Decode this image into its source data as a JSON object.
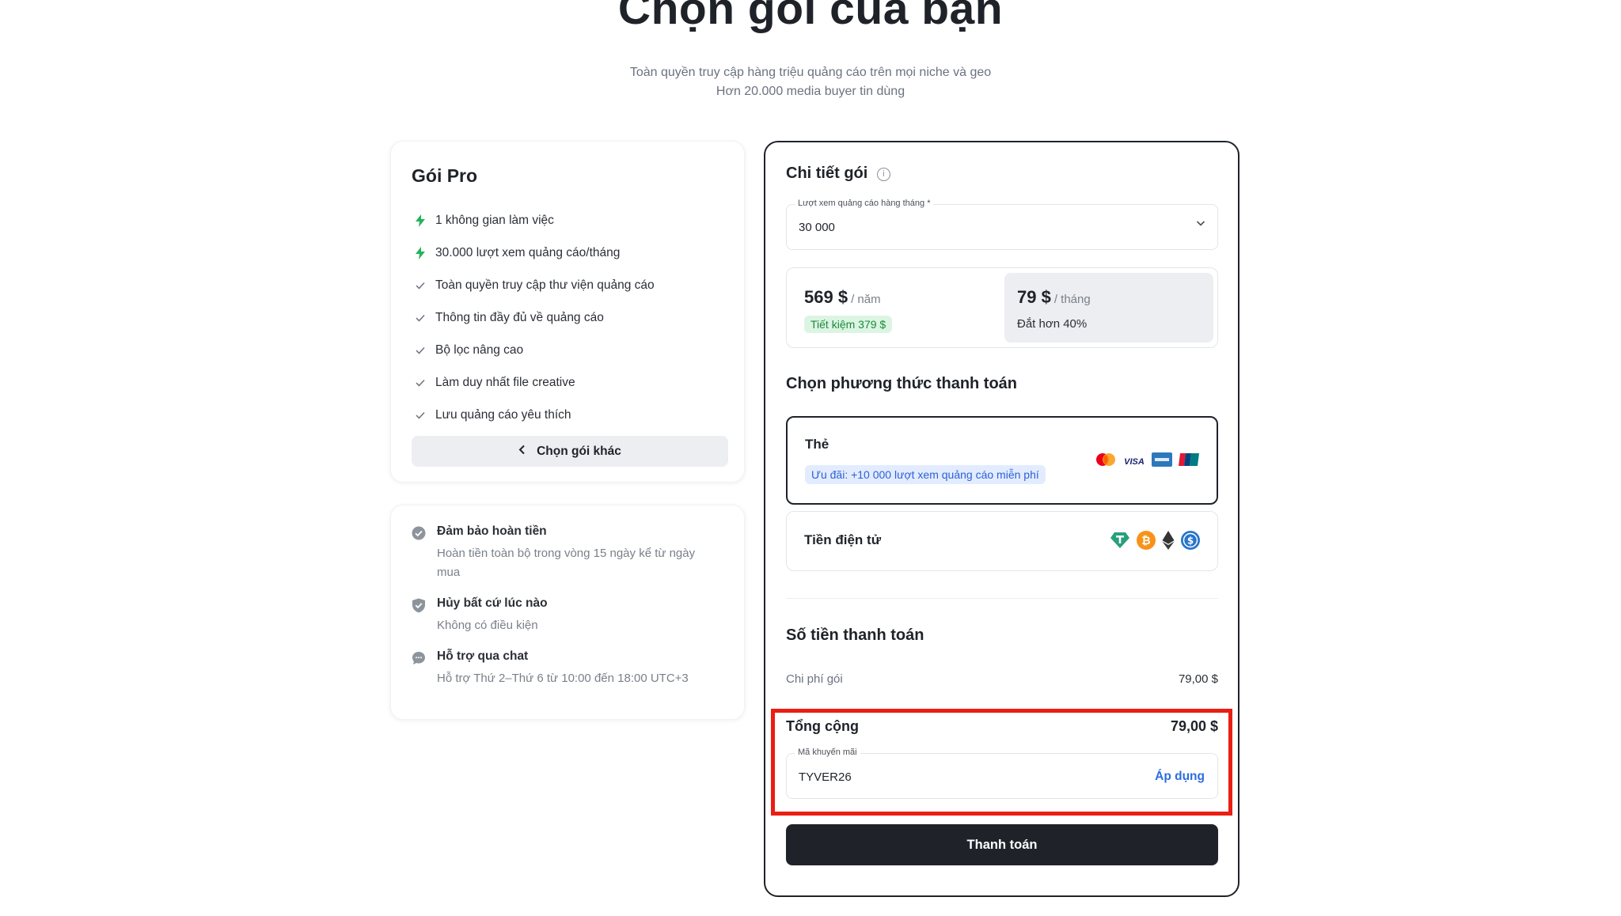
{
  "header": {
    "title": "Chọn gói của bạn",
    "subtitle_line1": "Toàn quyền truy cập hàng triệu quảng cáo trên mọi niche và geo",
    "subtitle_line2": "Hơn 20.000 media buyer tin dùng"
  },
  "plan": {
    "title": "Gói Pro",
    "features": [
      {
        "text": "1 không gian làm việc",
        "icon": "bolt-icon"
      },
      {
        "text": "30.000 lượt xem quảng cáo/tháng",
        "icon": "bolt-icon"
      },
      {
        "text": "Toàn quyền truy cập thư viện quảng cáo",
        "icon": "check-icon"
      },
      {
        "text": "Thông tin đầy đủ về quảng cáo",
        "icon": "check-icon"
      },
      {
        "text": "Bộ lọc nâng cao",
        "icon": "check-icon"
      },
      {
        "text": "Làm duy nhất file creative",
        "icon": "check-icon"
      },
      {
        "text": "Lưu quảng cáo yêu thích",
        "icon": "check-icon"
      }
    ],
    "other_plan_button": "Chọn gói khác"
  },
  "guarantees": [
    {
      "title": "Đảm bảo hoàn tiền",
      "desc": "Hoàn tiền toàn bộ trong vòng 15 ngày kể từ ngày mua",
      "icon": "badge-check-icon"
    },
    {
      "title": "Hủy bất cứ lúc nào",
      "desc": "Không có điều kiện",
      "icon": "shield-check-icon"
    },
    {
      "title": "Hỗ trợ qua chat",
      "desc": "Hỗ trợ Thứ 2–Thứ 6 từ 10:00 đến 18:00 UTC+3",
      "icon": "chat-icon"
    }
  ],
  "details": {
    "title": "Chi tiết gói",
    "views_label": "Lượt xem quảng cáo hàng tháng *",
    "views_value": "30 000",
    "yearly": {
      "price": "569 $",
      "unit": "/ năm",
      "badge": "Tiết kiệm 379 $"
    },
    "monthly": {
      "price": "79 $",
      "unit": "/ tháng",
      "note": "Đắt hơn 40%"
    },
    "payment_title": "Chọn phương thức thanh toán",
    "card_option": {
      "name": "Thẻ",
      "promo": "Ưu đãi: +10 000 lượt xem quảng cáo miễn phí"
    },
    "crypto_option": {
      "name": "Tiền điện tử"
    },
    "amount_title": "Số tiền thanh toán",
    "fee_label": "Chi phí gói",
    "fee_value": "79,00 $",
    "total_label": "Tổng cộng",
    "total_value": "79,00 $",
    "coupon_label": "Mã khuyến mãi",
    "coupon_value": "TYVER26",
    "apply_label": "Áp dụng",
    "pay_button": "Thanh toán",
    "visa_text": "VISA"
  },
  "colors": {
    "accent_dark": "#1f2329",
    "link_blue": "#2b6ee0",
    "highlight_red": "#ea1e12",
    "save_green": "#1b8a3c"
  }
}
